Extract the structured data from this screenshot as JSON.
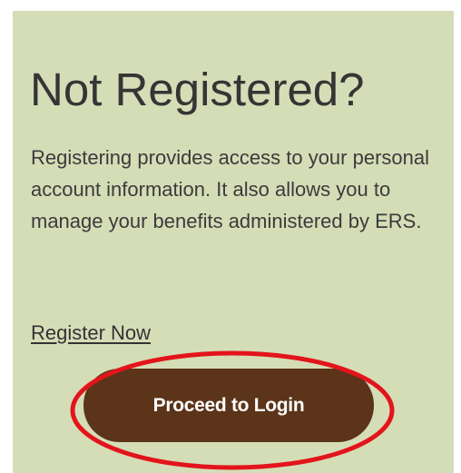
{
  "card": {
    "title": "Not Registered?",
    "description": "Registering provides access to your personal account information. It also allows you to manage your benefits administered by ERS.",
    "register_link_label": "Register Now",
    "login_button_label": "Proceed to Login"
  },
  "colors": {
    "card_background": "#d5ddb7",
    "button_background": "#5b3419",
    "highlight_annotation": "#e3141b"
  }
}
